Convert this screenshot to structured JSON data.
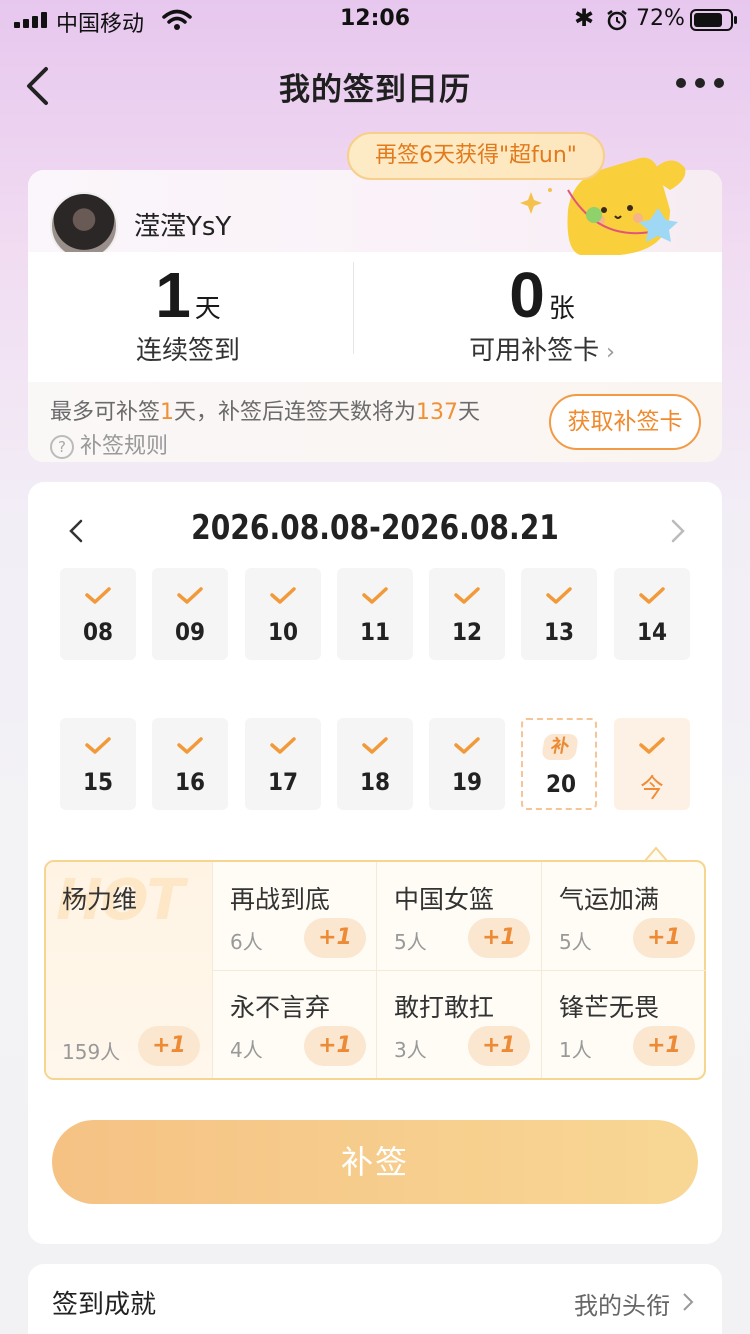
{
  "status_bar": {
    "carrier": "中国移动",
    "time": "12:06",
    "battery": "72%"
  },
  "nav": {
    "title": "我的签到日历"
  },
  "banner": "再签6天获得\"超fun\"",
  "user": {
    "name": "滢滢YsY"
  },
  "stats": {
    "streak_num": "1",
    "streak_unit": "天",
    "streak_label": "连续签到",
    "cards_num": "0",
    "cards_unit": "张",
    "cards_label": "可用补签卡"
  },
  "makeup": {
    "note_prefix": "最多可补签",
    "note_days": "1",
    "note_mid": "天，补签后连签天数将为",
    "note_total": "137",
    "note_suffix": "天",
    "rule": "补签规则",
    "get_card": "获取补签卡"
  },
  "calendar": {
    "range": "2026.08.08-2026.08.21",
    "row1": [
      "08",
      "09",
      "10",
      "11",
      "12",
      "13",
      "14"
    ],
    "row2": [
      "15",
      "16",
      "17",
      "18",
      "19"
    ],
    "makeup_day": {
      "tag": "补",
      "date": "20"
    },
    "today": "今"
  },
  "tags": {
    "hot_mark": "HOT",
    "featured": {
      "name": "杨力维",
      "count": "159人",
      "plus": "+1"
    },
    "items": [
      {
        "name": "再战到底",
        "count": "6人",
        "plus": "+1"
      },
      {
        "name": "中国女篮",
        "count": "5人",
        "plus": "+1"
      },
      {
        "name": "气运加满",
        "count": "5人",
        "plus": "+1"
      },
      {
        "name": "永不言弃",
        "count": "4人",
        "plus": "+1"
      },
      {
        "name": "敢打敢扛",
        "count": "3人",
        "plus": "+1"
      },
      {
        "name": "锋芒无畏",
        "count": "1人",
        "plus": "+1"
      }
    ]
  },
  "makeup_button": "补签",
  "achievements": {
    "title": "签到成就",
    "link": "我的头衔"
  },
  "colors": {
    "accent": "#f08a2e",
    "check": "#f29a3a",
    "button_start": "#f5c284",
    "button_end": "#f8d794"
  }
}
